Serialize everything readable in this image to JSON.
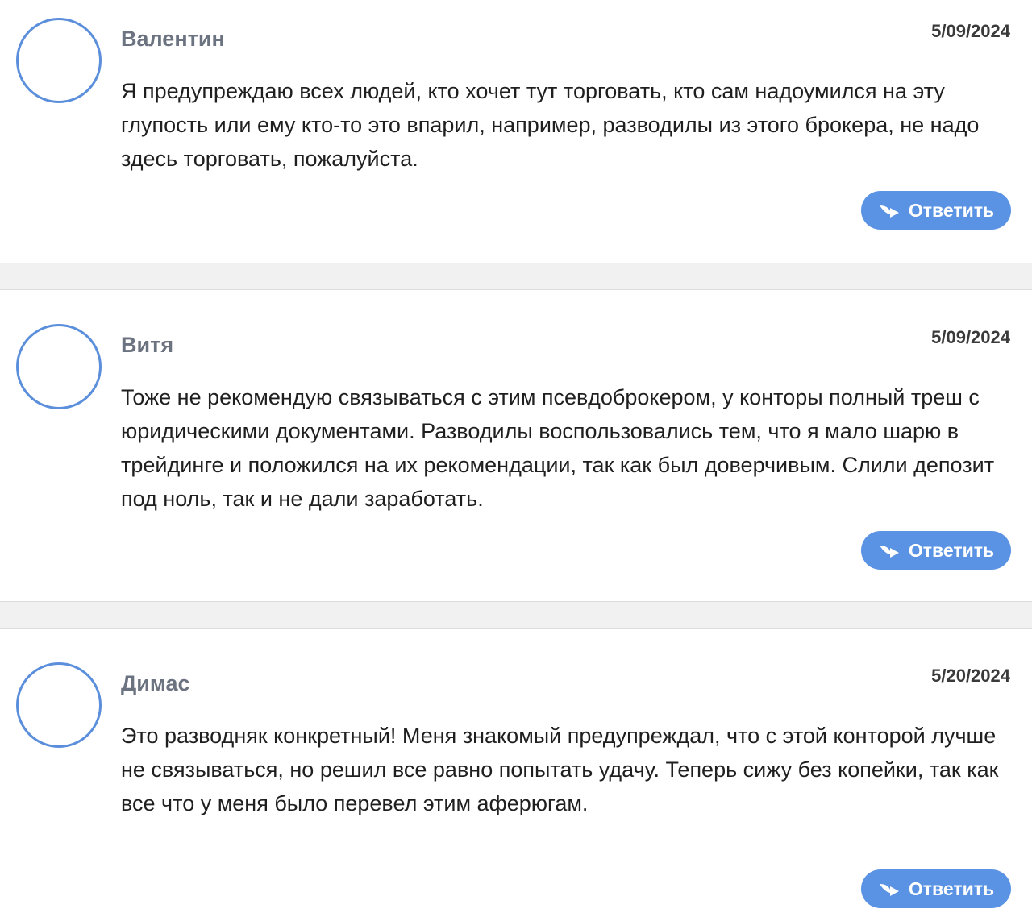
{
  "reply_label": "Ответить",
  "colors": {
    "accent": "#5a93e4",
    "avatar_border": "#5b8fdc",
    "author": "#6b7280",
    "separator": "#f1f1f1"
  },
  "icons": {
    "reply": "reply-arrow-icon"
  },
  "comments": [
    {
      "author": "Валентин",
      "date": "5/09/2024",
      "text": "Я предупреждаю всех людей, кто хочет тут торговать, кто сам надоумился на эту глупость или ему кто-то это впарил, например, разводилы из этого брокера, не надо здесь торговать, пожалуйста."
    },
    {
      "author": "Витя",
      "date": "5/09/2024",
      "text": "Тоже не рекомендую связываться с этим псевдоброкером, у конторы полный треш с юридическими документами. Разводилы воспользовались тем, что я мало шарю в трейдинге и положился на их рекомендации, так как был доверчивым. Слили депозит под ноль, так и не дали заработать."
    },
    {
      "author": "Димас",
      "date": "5/20/2024",
      "text": "Это разводняк конкретный! Меня знакомый предупреждал, что с этой конторой лучше не связываться, но решил все равно попытать удачу. Теперь сижу без копейки, так как все что у меня было перевел этим аферюгам."
    }
  ]
}
